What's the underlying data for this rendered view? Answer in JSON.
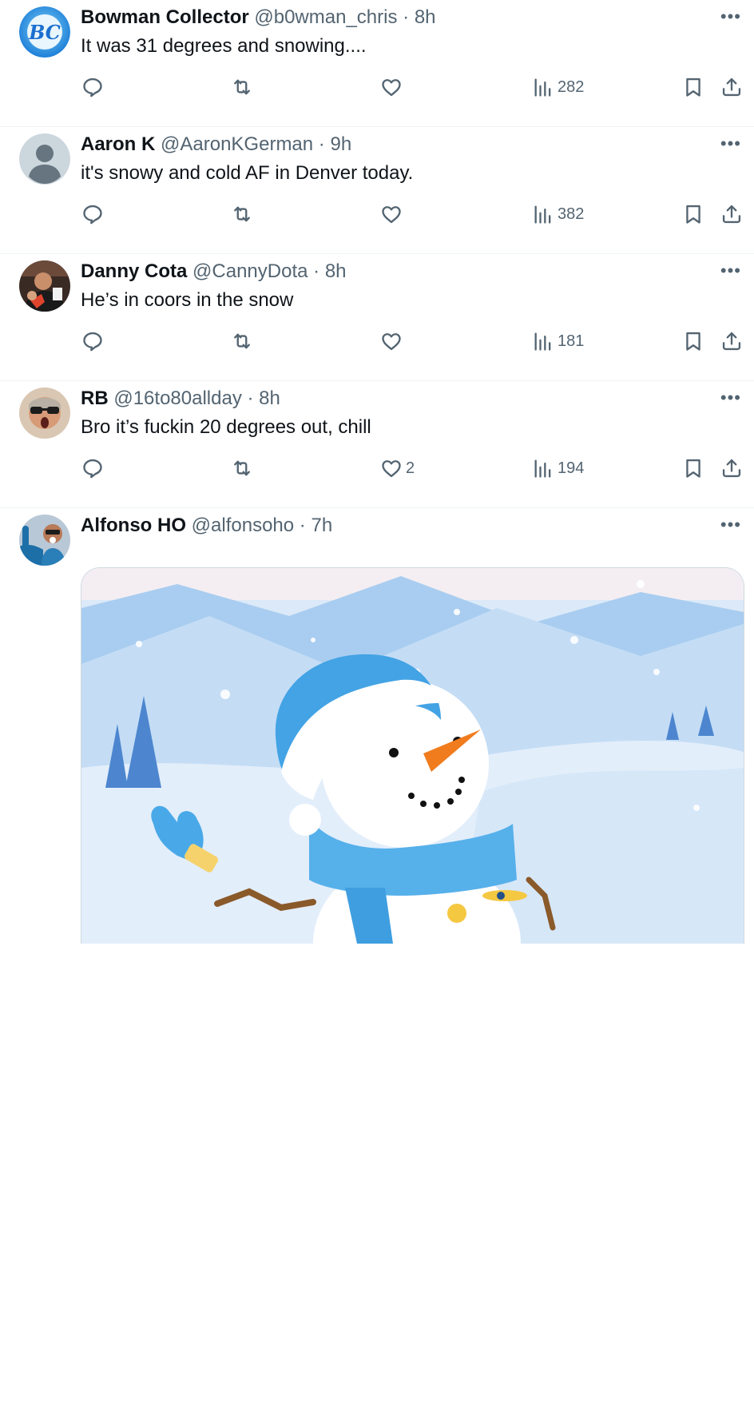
{
  "tweets": [
    {
      "name": "Bowman Collector",
      "handle": "@b0wman_chris",
      "sep": "·",
      "time": "8h",
      "text": "It was 31 degrees and snowing....",
      "likes": "",
      "views": "282",
      "avatar_text": "BC"
    },
    {
      "name": "Aaron K",
      "handle": "@AaronKGerman",
      "sep": "·",
      "time": "9h",
      "text": "it's snowy and cold AF in Denver today.",
      "likes": "",
      "views": "382"
    },
    {
      "name": "Danny Cota",
      "handle": "@CannyDota",
      "sep": "·",
      "time": "8h",
      "text": "He’s in coors in the snow",
      "likes": "",
      "views": "181"
    },
    {
      "name": "RB",
      "handle": "@16to80allday",
      "sep": "·",
      "time": "8h",
      "text": "Bro it’s fuckin 20 degrees out, chill",
      "likes": "2",
      "views": "194"
    },
    {
      "name": "Alfonso HO",
      "handle": "@alfonsoho",
      "sep": "·",
      "time": "7h"
    }
  ],
  "more_label": "•••",
  "icons": [
    "reply-icon",
    "retweet-icon",
    "like-icon",
    "views-icon",
    "bookmark-icon",
    "share-icon",
    "more-icon"
  ],
  "colors": {
    "text": "#0f1419",
    "secondary": "#536471",
    "divider": "#eff3f4"
  }
}
